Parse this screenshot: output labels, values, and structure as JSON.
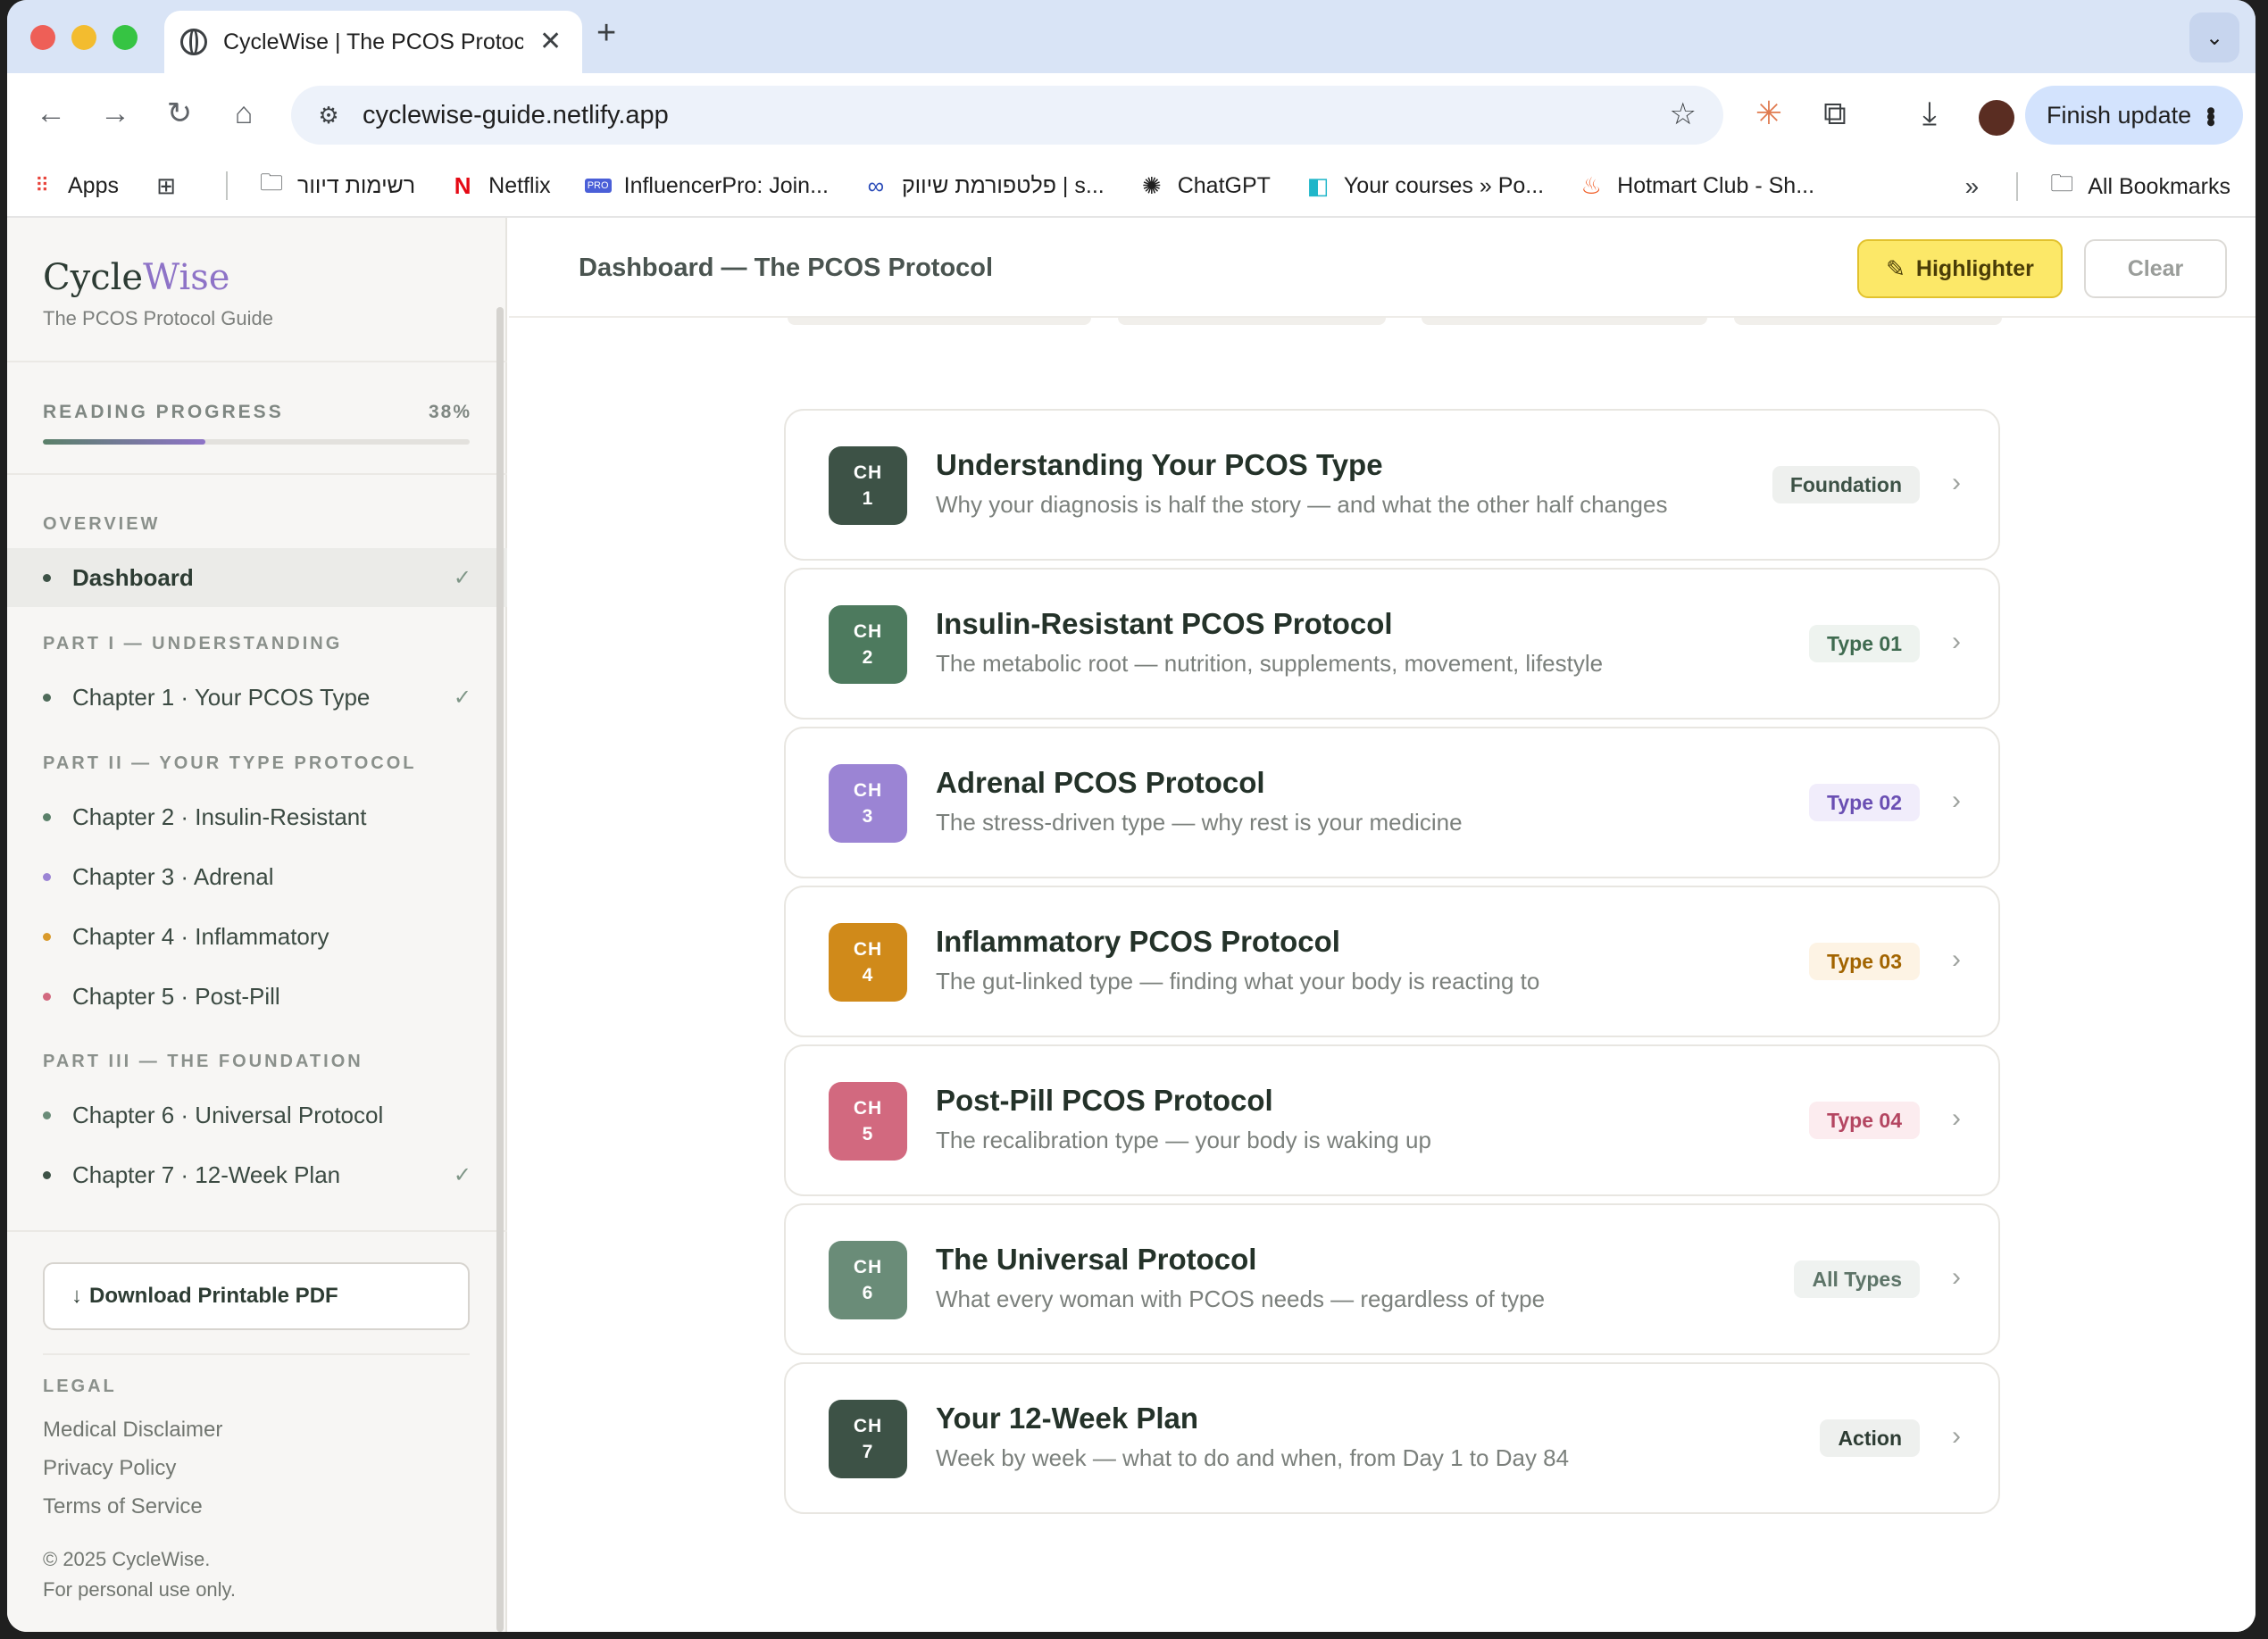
{
  "browser": {
    "tab_title": "CycleWise | The PCOS Protoc",
    "url": "cyclewise-guide.netlify.app",
    "finish_update": "Finish update",
    "bookmarks": [
      {
        "label": "Apps",
        "icon": "apps-grid-icon"
      },
      {
        "label": "רשימות דיוור",
        "icon": "folder-icon"
      },
      {
        "label": "Netflix",
        "icon": "netflix-icon"
      },
      {
        "label": "InfluencerPro: Join...",
        "icon": "pro-badge-icon"
      },
      {
        "label": "פלטפורמת שיווק | s...",
        "icon": "loop-icon"
      },
      {
        "label": "ChatGPT",
        "icon": "chatgpt-icon"
      },
      {
        "label": "Your courses » Po...",
        "icon": "courses-icon"
      },
      {
        "label": "Hotmart Club - Sh...",
        "icon": "flame-icon"
      }
    ],
    "all_bookmarks": "All Bookmarks"
  },
  "sidebar": {
    "brand_cycle": "Cycle",
    "brand_wise": "Wise",
    "brand_subtitle": "The PCOS Protocol Guide",
    "progress_label": "READING PROGRESS",
    "progress_value": "38%",
    "progress_fraction": 0.38,
    "sections": {
      "overview": "OVERVIEW",
      "part1": "PART I — UNDERSTANDING",
      "part2": "PART II — YOUR TYPE PROTOCOL",
      "part3": "PART III — THE FOUNDATION"
    },
    "items": [
      {
        "label": "Dashboard",
        "dot": "#3d5246",
        "checked": true,
        "active": true
      },
      {
        "label": "Chapter 1 · Your PCOS Type",
        "dot": "#4f6b5a",
        "checked": true
      },
      {
        "label": "Chapter 2 · Insulin-Resistant",
        "dot": "#5a8069",
        "checked": false
      },
      {
        "label": "Chapter 3 · Adrenal",
        "dot": "#9b84d4",
        "checked": false
      },
      {
        "label": "Chapter 4 · Inflammatory",
        "dot": "#d99a2b",
        "checked": false
      },
      {
        "label": "Chapter 5 · Post-Pill",
        "dot": "#d2697f",
        "checked": false
      },
      {
        "label": "Chapter 6 · Universal Protocol",
        "dot": "#6a8c78",
        "checked": false
      },
      {
        "label": "Chapter 7 · 12-Week Plan",
        "dot": "#3d5246",
        "checked": true
      }
    ],
    "check_mark": "✓",
    "pdf_button": "Download Printable PDF",
    "legal_heading": "LEGAL",
    "legal_links": [
      "Medical Disclaimer",
      "Privacy Policy",
      "Terms of Service"
    ],
    "copyright": "© 2025 CycleWise.",
    "personal_use": "For personal use only."
  },
  "main": {
    "title": "Dashboard — The PCOS Protocol",
    "highlighter_label": "Highlighter",
    "clear_label": "Clear",
    "chapters": [
      {
        "ch": "CH",
        "num": "1",
        "title": "Understanding Your PCOS Type",
        "subtitle": "Why your diagnosis is half the story — and what the other half changes",
        "tag": "Foundation",
        "badge_color": "#3d5246",
        "tag_bg": "#eef0ee",
        "tag_color": "#3d5246"
      },
      {
        "ch": "CH",
        "num": "2",
        "title": "Insulin-Resistant PCOS Protocol",
        "subtitle": "The metabolic root — nutrition, supplements, movement, lifestyle",
        "tag": "Type 01",
        "badge_color": "#4d7a5e",
        "tag_bg": "#eef3ef",
        "tag_color": "#3f6b50"
      },
      {
        "ch": "CH",
        "num": "3",
        "title": "Adrenal PCOS Protocol",
        "subtitle": "The stress-driven type — why rest is your medicine",
        "tag": "Type 02",
        "badge_color": "#9b84d4",
        "tag_bg": "#f1edfb",
        "tag_color": "#6a4fb3"
      },
      {
        "ch": "CH",
        "num": "4",
        "title": "Inflammatory PCOS Protocol",
        "subtitle": "The gut-linked type — finding what your body is reacting to",
        "tag": "Type 03",
        "badge_color": "#d08a1a",
        "tag_bg": "#fdf3e4",
        "tag_color": "#a26400"
      },
      {
        "ch": "CH",
        "num": "5",
        "title": "Post-Pill PCOS Protocol",
        "subtitle": "The recalibration type — your body is waking up",
        "tag": "Type 04",
        "badge_color": "#d2697f",
        "tag_bg": "#fcecef",
        "tag_color": "#b44661"
      },
      {
        "ch": "CH",
        "num": "6",
        "title": "The Universal Protocol",
        "subtitle": "What every woman with PCOS needs — regardless of type",
        "tag": "All Types",
        "badge_color": "#6a8c78",
        "tag_bg": "#eff2f0",
        "tag_color": "#5d7468"
      },
      {
        "ch": "CH",
        "num": "7",
        "title": "Your 12-Week Plan",
        "subtitle": "Week by week — what to do and when, from Day 1 to Day 84",
        "tag": "Action",
        "badge_color": "#3d5246",
        "tag_bg": "#eef0ee",
        "tag_color": "#2d3c33"
      }
    ]
  }
}
